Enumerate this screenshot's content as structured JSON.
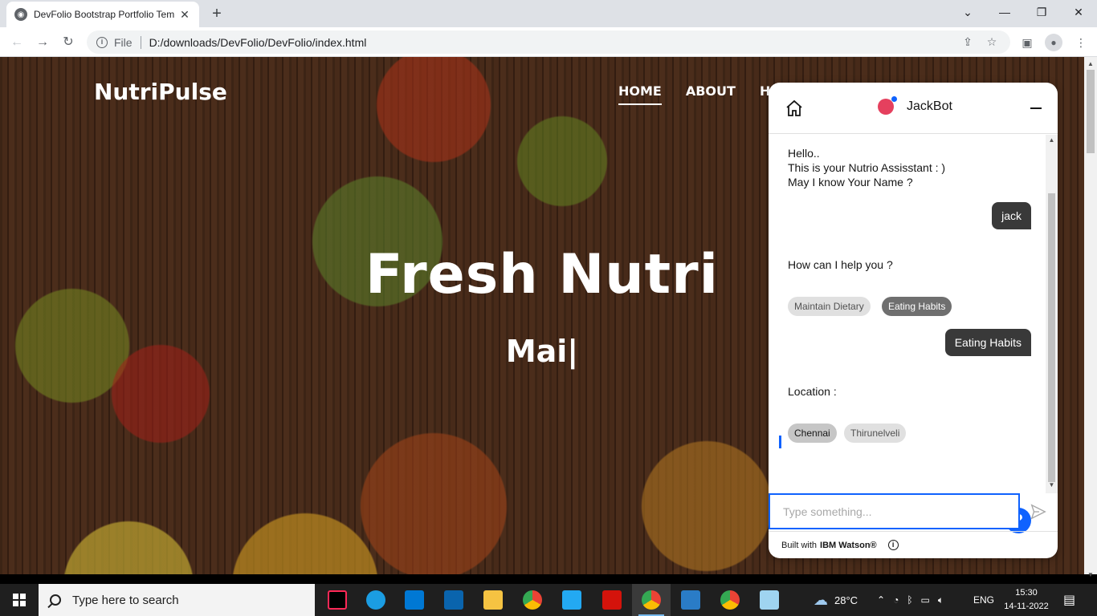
{
  "browser": {
    "tab_title": "DevFolio Bootstrap Portfolio Tem",
    "tab_close": "✕",
    "new_tab": "+",
    "address_scheme_label": "File",
    "url": "D:/downloads/DevFolio/DevFolio/index.html",
    "window_controls": {
      "collapse": "⌄",
      "minimize": "—",
      "restore": "❐",
      "close": "✕"
    }
  },
  "site": {
    "brand": "NutriPulse",
    "nav": [
      {
        "label": "HOME",
        "active": true
      },
      {
        "label": "ABOUT",
        "active": false
      },
      {
        "label": "HEA",
        "active": false
      }
    ],
    "hero_title": "Fresh Nutri",
    "hero_subtitle": "Mai|"
  },
  "chat": {
    "bot_name": "JackBot",
    "messages": {
      "greeting": [
        "Hello..",
        "This is your Nutrio Assisstant : )",
        "May I know Your Name ?"
      ],
      "user_name": "jack",
      "help_prompt": "How can I help you ?",
      "option_chips": [
        "Maintain Dietary",
        "Eating Habits"
      ],
      "user_choice": "Eating Habits",
      "location_prompt": "Location :",
      "location_chips": [
        "Chennai",
        "Thirunelveli"
      ]
    },
    "help_button": "?",
    "input_placeholder": "Type something...",
    "footer_prefix": "Built with",
    "footer_brand": "IBM Watson®",
    "footer_info": "i",
    "colors": {
      "accent": "#0f62fe",
      "user_bubble": "#393939",
      "chip_selected": "#6f6f6f"
    }
  },
  "taskbar": {
    "search_placeholder": "Type here to search",
    "apps": [
      "intellij-icon",
      "edge-icon",
      "store-icon",
      "mail-icon",
      "explorer-icon",
      "chrome-icon",
      "vscode-icon",
      "acrobat-icon",
      "chrome-active-icon",
      "photos-icon",
      "chrome-profile-icon",
      "notepad-icon"
    ],
    "weather": "28°C",
    "language": "ENG",
    "time": "15:30",
    "date": "14-11-2022"
  }
}
